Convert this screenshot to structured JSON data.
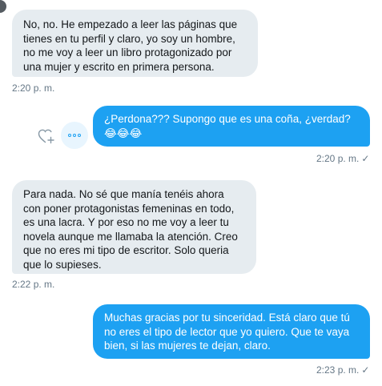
{
  "messages": [
    {
      "text": "No, no. He empezado a leer las páginas que\ntienes en tu perfil y claro, yo soy un hombre,\nno me voy a leer un libro protagonizado por\nuna mujer y escrito en primera persona.",
      "time": "2:20 p. m."
    },
    {
      "text": "¿Perdona??? Supongo que es una coña, ¿verdad?\n😂😂😂",
      "time": "2:20 p. m."
    },
    {
      "text": "Para nada. No sé que manía tenéis ahora\ncon poner protagonistas femeninas en todo,\nes una lacra. Y por eso no me voy a leer tu\nnovela aunque me llamaba la atención. Creo\nque no eres mi tipo de escritor. Solo queria\nque lo supieses.",
      "time": "2:22 p. m."
    },
    {
      "text": "Muchas gracias por tu sinceridad. Está claro que tú\nno eres el tipo de lector que yo quiero. Que te vaya\nbien, si las mujeres te dejan, claro.",
      "time": "2:23 p. m."
    }
  ],
  "status": {
    "check": "✓"
  },
  "icons": {
    "like": "heart-plus-icon",
    "more": "more-options-icon"
  },
  "colors": {
    "incoming": "#e6ecf0",
    "outgoing": "#1da1f2",
    "timestamp": "#657786"
  }
}
